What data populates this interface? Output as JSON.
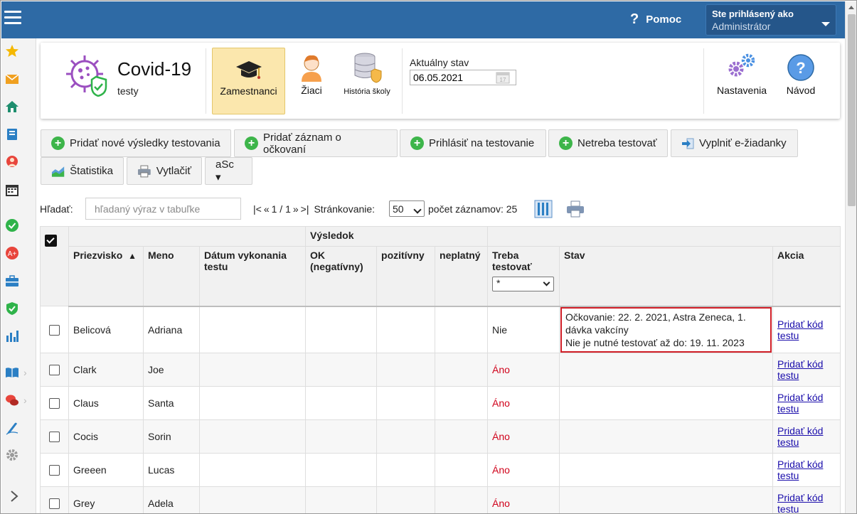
{
  "topbar": {
    "help_label": "Pomoc",
    "user_line1": "Ste prihlásený ako",
    "user_line2": "Administrátor"
  },
  "sidebar": {
    "icons": [
      "star-icon",
      "mail-icon",
      "home-icon",
      "notebook-icon",
      "person-icon",
      "calendar-icon",
      "check-circle-icon",
      "grade-icon",
      "briefcase-icon",
      "shield-check-icon",
      "bar-chart-icon",
      "book-icon",
      "chat-icon",
      "pencil-icon",
      "gear-icon",
      "expand-chevron-icon"
    ]
  },
  "app": {
    "title": "Covid-19",
    "subtitle": "testy",
    "modules": [
      {
        "label": "Zamestnanci",
        "active": true
      },
      {
        "label": "Žiaci",
        "active": false
      },
      {
        "label": "História školy",
        "active": false
      }
    ],
    "state_label": "Aktuálny stav",
    "state_date": "06.05.2021",
    "right_modules": [
      {
        "label": "Nastavenia"
      },
      {
        "label": "Návod"
      }
    ]
  },
  "toolbar": {
    "row1": [
      "Pridať nové výsledky testovania",
      "Pridať záznam o očkovaní",
      "Prihlásiť na testovanie",
      "Netreba testovať",
      "Vyplniť e-žiadanky"
    ],
    "row2": [
      "Štatistika",
      "Vytlačiť",
      "aSc ▾"
    ]
  },
  "search": {
    "label": "Hľadať:",
    "placeholder": "hľadaný výraz v tabuľke"
  },
  "pager": {
    "first": "|<",
    "prev": "«",
    "page_text": "1 / 1",
    "next": "»",
    "last": ">|",
    "paging_label": "Stránkovanie:",
    "page_size": "50",
    "count_label": "počet záznamov: 25"
  },
  "table": {
    "group_header": "Výsledok",
    "headers": {
      "surname": "Priezvisko",
      "sort_indicator": "▲",
      "name": "Meno",
      "date": "Dátum vykonania testu",
      "ok": "OK (negatívny)",
      "positive": "pozitívny",
      "invalid": "neplatný",
      "need": "Treba testovať",
      "need_filter": "*",
      "state": "Stav",
      "action": "Akcia"
    },
    "rows": [
      {
        "surname": "Belicová",
        "name": "Adriana",
        "need": "Nie",
        "state_line1": "Očkovanie: 22. 2. 2021, Astra Zeneca, 1. dávka vakcíny",
        "state_line2": "Nie je nutné testovať až do: 19. 11. 2023",
        "action": "Pridať kód testu"
      },
      {
        "surname": "Clark",
        "name": "Joe",
        "need": "Áno",
        "state_line1": "",
        "state_line2": "",
        "action": "Pridať kód testu"
      },
      {
        "surname": "Claus",
        "name": "Santa",
        "need": "Áno",
        "state_line1": "",
        "state_line2": "",
        "action": "Pridať kód testu"
      },
      {
        "surname": "Cocis",
        "name": "Sorin",
        "need": "Áno",
        "state_line1": "",
        "state_line2": "",
        "action": "Pridať kód testu"
      },
      {
        "surname": "Greeen",
        "name": "Lucas",
        "need": "Áno",
        "state_line1": "",
        "state_line2": "",
        "action": "Pridať kód testu"
      },
      {
        "surname": "Grey",
        "name": "Adela",
        "need": "Áno",
        "state_line1": "",
        "state_line2": "",
        "action": "Pridať kód testu"
      }
    ]
  },
  "colors": {
    "topbar": "#2e6aa5",
    "active_module": "#fbe7ad",
    "highlight_border": "#d01f27",
    "yes_red": "#d0021b",
    "link": "#1a0dab"
  }
}
